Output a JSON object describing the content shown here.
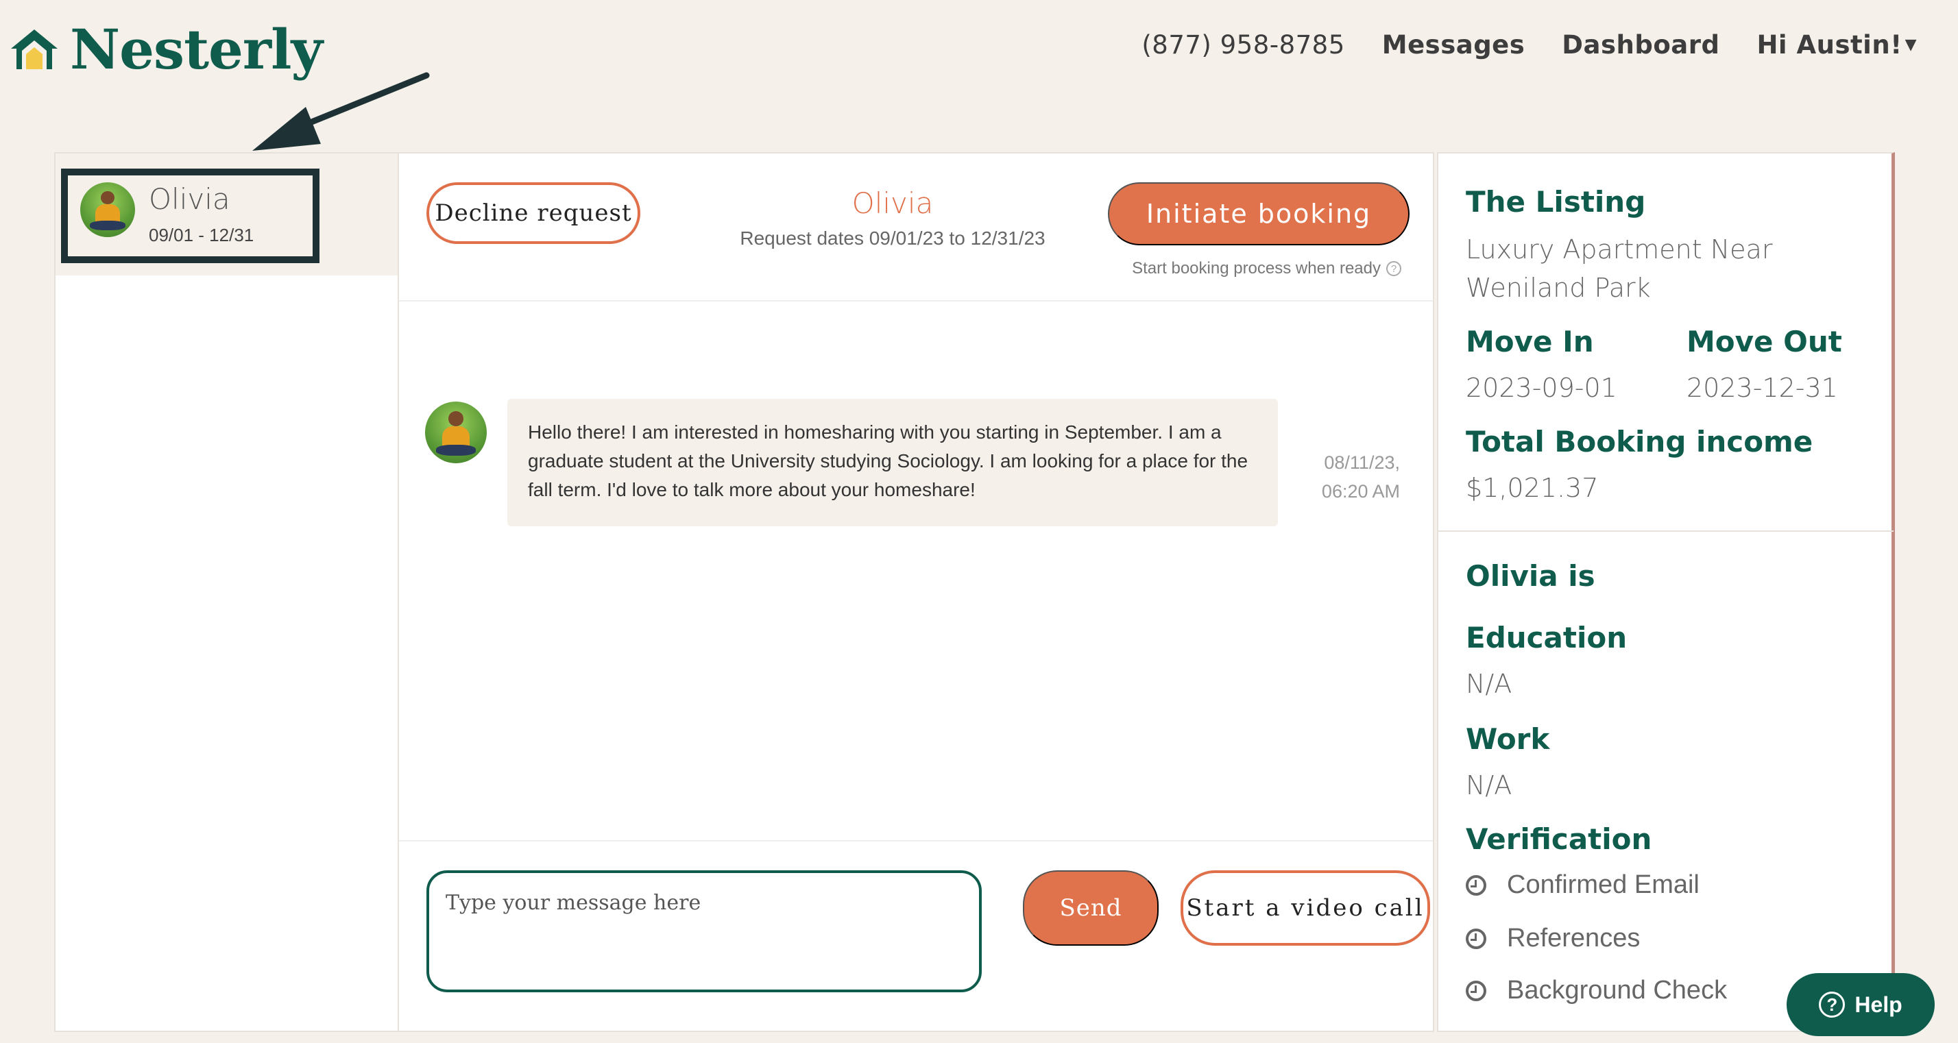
{
  "brand": {
    "name": "Nesterly"
  },
  "nav": {
    "phone": "(877) 958-8785",
    "messages": "Messages",
    "dashboard": "Dashboard",
    "user": "Hi Austin!"
  },
  "conversations": [
    {
      "name": "Olivia",
      "dates": "09/01 - 12/31"
    }
  ],
  "chat": {
    "decline_label": "Decline request",
    "title": "Olivia",
    "subtitle": "Request dates 09/01/23 to 12/31/23",
    "initiate_label": "Initiate booking",
    "initiate_hint": "Start booking process when ready",
    "messages": [
      {
        "text": "Hello there! I am interested in homesharing with you starting in September. I am a graduate student at the University studying Sociology. I am looking for a place for the fall term. I'd love to talk more about your homeshare!",
        "date": "08/11/23,",
        "time": "06:20 AM"
      }
    ],
    "input_placeholder": "Type your message here",
    "send_label": "Send",
    "video_label": "Start a video call"
  },
  "listing": {
    "heading": "The Listing",
    "name": "Luxury Apartment Near Weniland Park",
    "move_in_label": "Move In",
    "move_in": "2023-09-01",
    "move_out_label": "Move Out",
    "move_out": "2023-12-31",
    "income_label": "Total Booking income",
    "income": "$1,021.37"
  },
  "profile": {
    "heading": "Olivia is",
    "education_label": "Education",
    "education": "N/A",
    "work_label": "Work",
    "work": "N/A",
    "verification_label": "Verification",
    "verifications": [
      "Confirmed Email",
      "References",
      "Background Check"
    ]
  },
  "help": {
    "label": "Help"
  },
  "colors": {
    "brand_green": "#0f5c4d",
    "accent_orange": "#e0734b",
    "background": "#f5f0ea",
    "highlight_box": "#1e3236"
  }
}
